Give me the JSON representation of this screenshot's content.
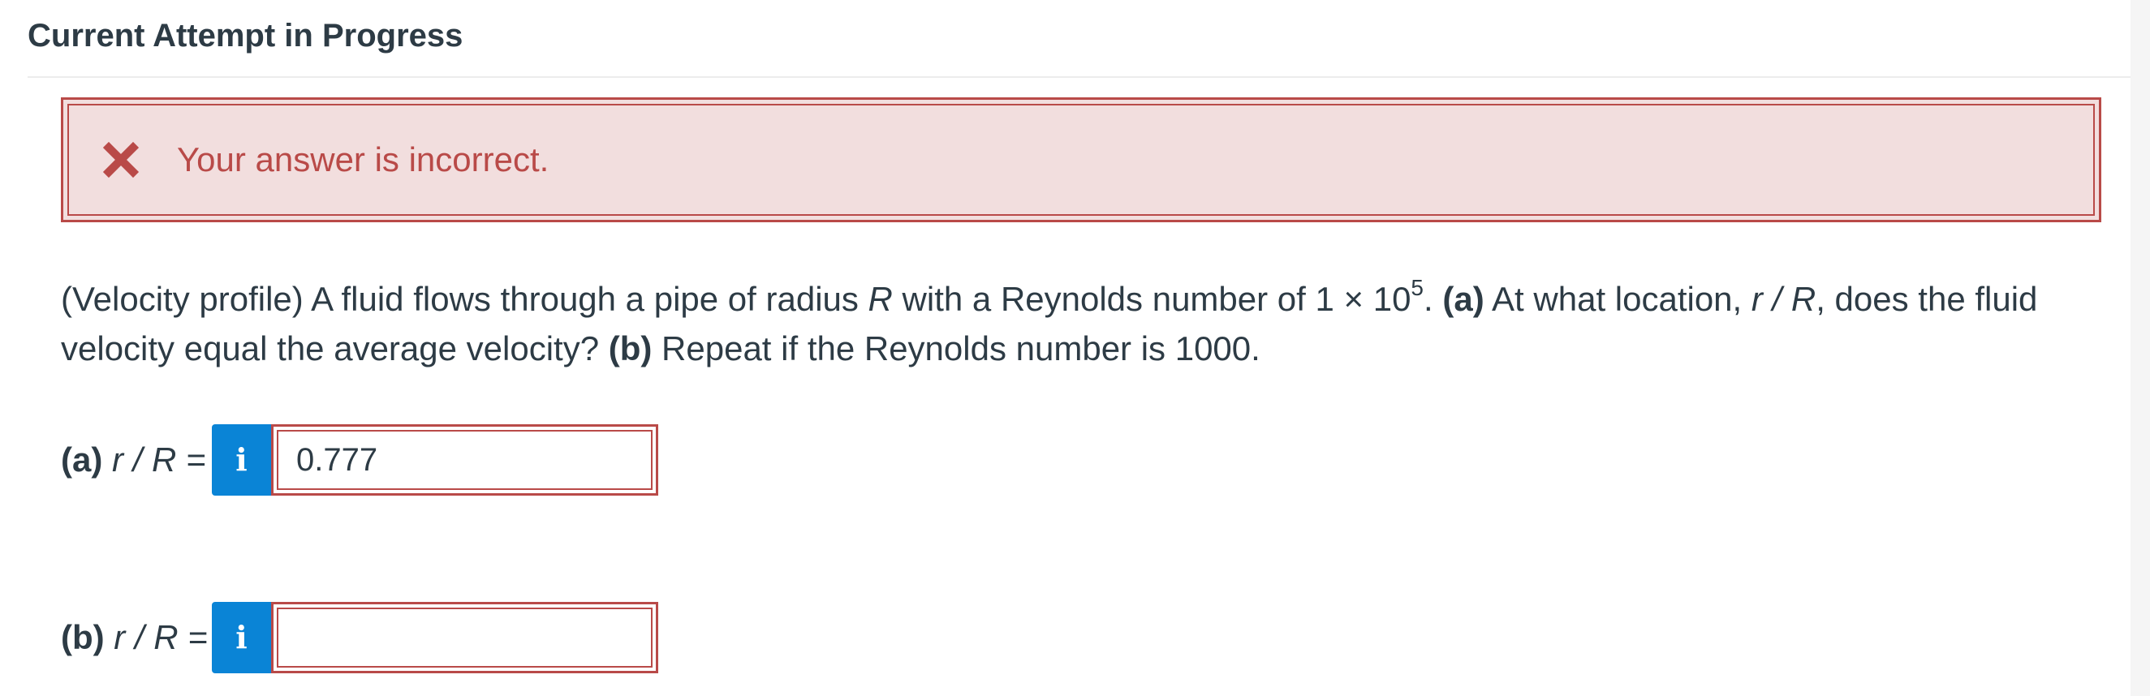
{
  "page": {
    "title": "Current Attempt in Progress"
  },
  "alert": {
    "message": "Your answer is incorrect.",
    "icon": "x-icon",
    "color": "#b94a48",
    "background": "#f2dede"
  },
  "question": {
    "part1": "(Velocity profile) A fluid flows through a pipe of radius ",
    "var_R": "R",
    "part2": " with a Reynolds number of 1 × 10",
    "exponent": "5",
    "part3": ". ",
    "label_a": "(a)",
    "part4": " At what location, ",
    "var_rR": "r / R",
    "part5": ", does the fluid velocity equal the average velocity? ",
    "label_b": "(b)",
    "part6": " Repeat if the Reynolds number is 1000."
  },
  "answers": [
    {
      "label_bold": "(a)",
      "label_var": " r / R =",
      "info_icon": "i",
      "value": "0.777",
      "placeholder": ""
    },
    {
      "label_bold": "(b)",
      "label_var": " r / R =",
      "info_icon": "i",
      "value": "",
      "placeholder": ""
    }
  ],
  "colors": {
    "info_button": "#0a84d6",
    "error_border": "#b94a48",
    "text": "#2d3b45"
  }
}
